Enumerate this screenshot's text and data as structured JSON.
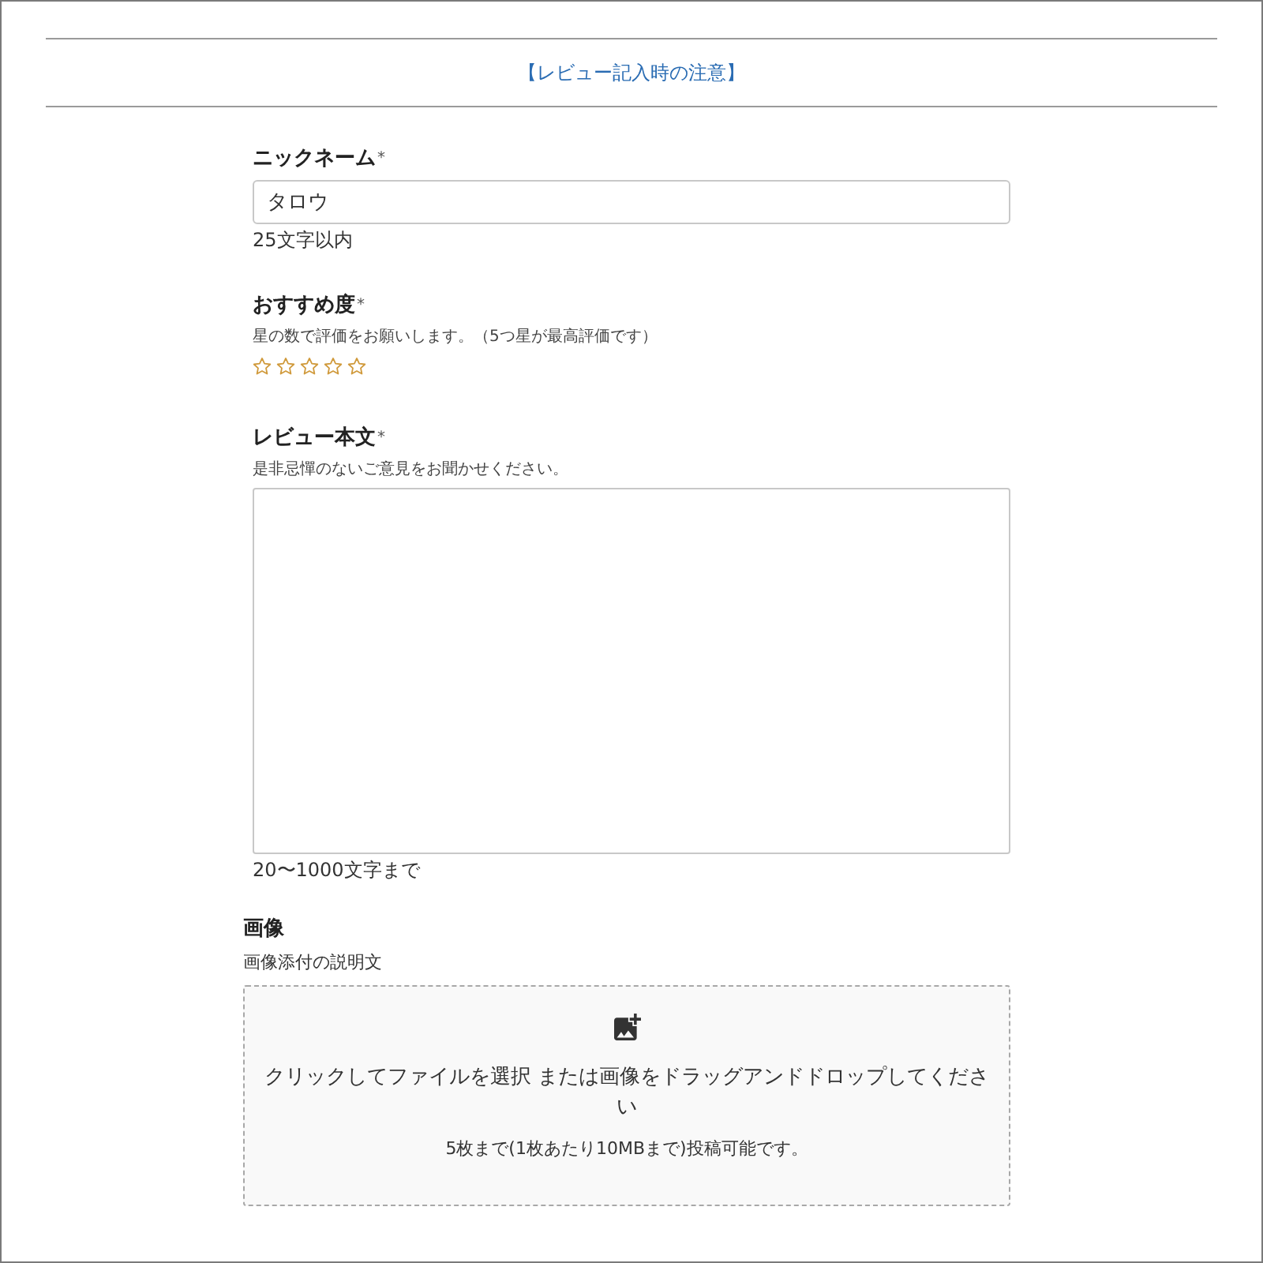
{
  "notice_link": {
    "label": "【レビュー記入時の注意】"
  },
  "fields": [
    {
      "kind": "text",
      "label": "ニックネーム",
      "required_mark": "*",
      "value": "タロウ",
      "hint": "25文字以内"
    },
    {
      "kind": "rating",
      "label": "おすすめ度",
      "required_mark": "*",
      "description": "星の数で評価をお願いします。（5つ星が最高評価です）",
      "stars": 0
    },
    {
      "kind": "textarea",
      "label": "レビュー本文",
      "required_mark": "*",
      "description": "是非忌憚のないご意見をお聞かせください。",
      "hint": "20〜1000文字まで"
    },
    {
      "kind": "image_upload",
      "label": "画像",
      "description": "画像添付の説明文",
      "dropzone": {
        "text": "クリックしてファイルを選択 または画像をドラッグアンドドロップしてください",
        "note": "5枚まで(1枚あたり10MBまで)投稿可能です。"
      }
    }
  ]
}
